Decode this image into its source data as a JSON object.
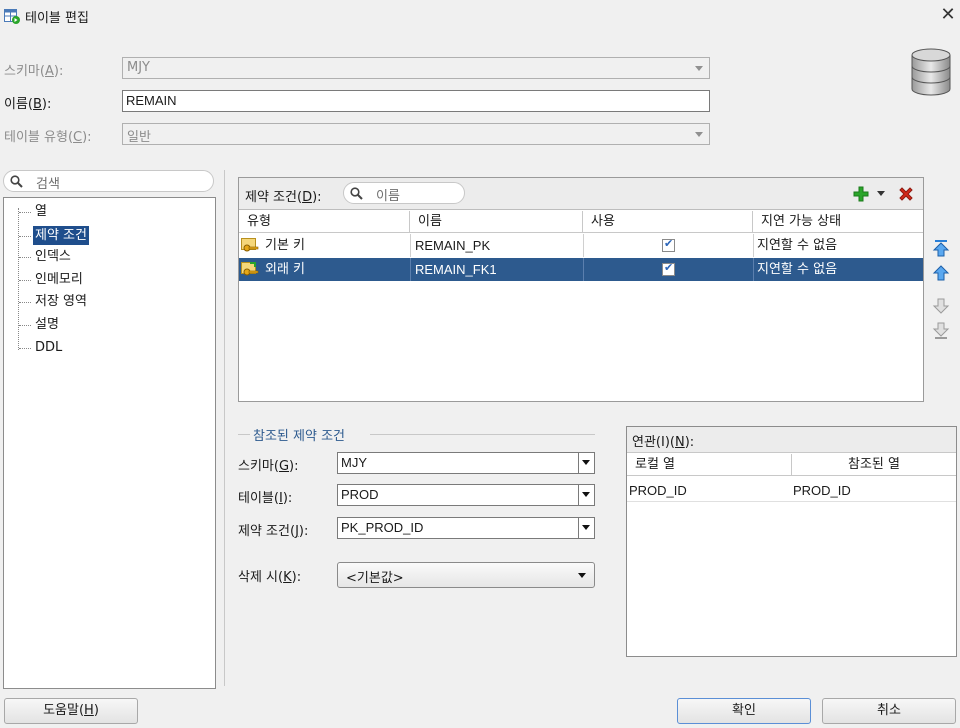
{
  "window": {
    "title": "테이블 편집"
  },
  "form": {
    "schema": {
      "label": "스키마",
      "accel": "A",
      "value": "MJY"
    },
    "name": {
      "label": "이름",
      "accel": "B",
      "value": "REMAIN"
    },
    "table_type": {
      "label": "테이블 유형",
      "accel": "C",
      "value": "일반"
    }
  },
  "tree": {
    "search_placeholder": "검색",
    "items": [
      "열",
      "제약 조건",
      "인덱스",
      "인메모리",
      "저장 영역",
      "설명",
      "DDL"
    ],
    "selected_index": 1
  },
  "constraints": {
    "label": "제약 조건",
    "accel": "D",
    "filter_placeholder": "이름",
    "columns": [
      "유형",
      "이름",
      "사용",
      "지연 가능 상태"
    ],
    "rows": [
      {
        "type": "기본 키",
        "icon": "primary-key-icon",
        "name": "REMAIN_PK",
        "enabled": true,
        "deferrable": "지연할 수 없음"
      },
      {
        "type": "외래 키",
        "icon": "foreign-key-icon",
        "name": "REMAIN_FK1",
        "enabled": true,
        "deferrable": "지연할 수 없음",
        "selected": true
      }
    ]
  },
  "referenced": {
    "group_label": "참조된 제약 조건",
    "schema": {
      "label": "스키마",
      "accel": "G",
      "value": "MJY"
    },
    "table": {
      "label": "테이블",
      "accel": "I",
      "value": "PROD"
    },
    "constraint": {
      "label": "제약 조건",
      "accel": "J",
      "value": "PK_PROD_ID"
    },
    "on_delete": {
      "label": "삭제 시",
      "accel": "K",
      "value": "<기본값>"
    }
  },
  "association": {
    "label": "연관(I)",
    "accel": "N",
    "columns": [
      "로컬 열",
      "참조된 열"
    ],
    "rows": [
      {
        "local": "PROD_ID",
        "referenced": "PROD_ID"
      }
    ]
  },
  "buttons": {
    "help": {
      "label": "도움말",
      "accel": "H"
    },
    "ok": "확인",
    "cancel": "취소"
  },
  "colors": {
    "selection": "#2d5a8e",
    "add": "#2aa52a",
    "delete": "#d42a1a",
    "arrow": "#2a7fd6"
  }
}
